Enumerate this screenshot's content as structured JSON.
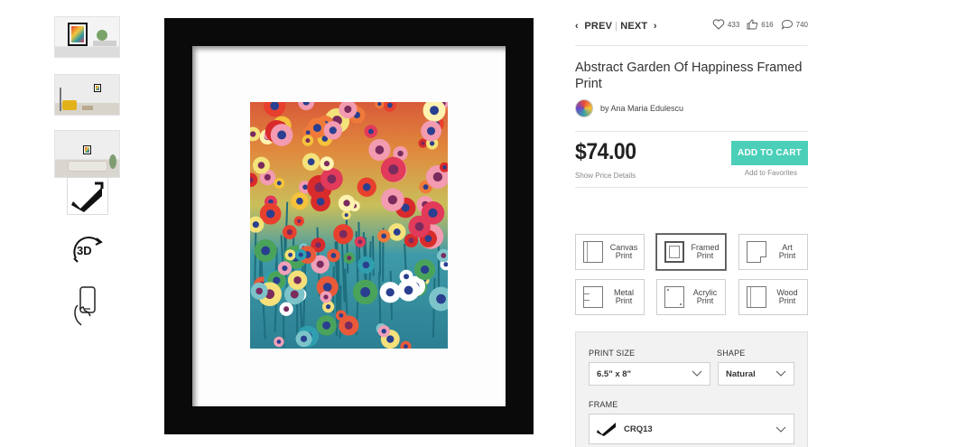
{
  "thumbnails": [
    {
      "name": "framed-print-on-shelf"
    },
    {
      "name": "framed-print-room-yellow-chair"
    },
    {
      "name": "framed-print-living-room-sofa"
    }
  ],
  "view_icons": {
    "frame_corner": "frame-corner-icon",
    "rotate_3d": "3D",
    "ar_phone": "phone-ar-icon"
  },
  "nav": {
    "prev": "PREV",
    "next": "NEXT",
    "prev_arrow": "‹",
    "next_arrow": "›",
    "separator": "|"
  },
  "social": {
    "likes": "433",
    "thumbs": "616",
    "comments": "740"
  },
  "product": {
    "title": "Abstract Garden Of Happiness Framed Print",
    "artist": "by Ana Maria Edulescu",
    "price": "$74.00",
    "price_details": "Show Price Details",
    "add_to_cart": "ADD TO CART",
    "add_to_favorites": "Add to Favorites"
  },
  "product_types": [
    {
      "label_1": "Canvas",
      "label_2": "Print",
      "active": false
    },
    {
      "label_1": "Framed",
      "label_2": "Print",
      "active": true
    },
    {
      "label_1": "Art",
      "label_2": "Print",
      "active": false
    },
    {
      "label_1": "Metal",
      "label_2": "Print",
      "active": false
    },
    {
      "label_1": "Acrylic",
      "label_2": "Print",
      "active": false
    },
    {
      "label_1": "Wood",
      "label_2": "Print",
      "active": false
    }
  ],
  "options": {
    "print_size_label": "PRINT SIZE",
    "print_size_value": "6.5\" x 8\"",
    "shape_label": "SHAPE",
    "shape_value": "Natural",
    "frame_label": "FRAME",
    "frame_value": "CRQ13"
  },
  "colors": {
    "accent": "#4ccfb9",
    "frame": "#0a0a0a"
  }
}
